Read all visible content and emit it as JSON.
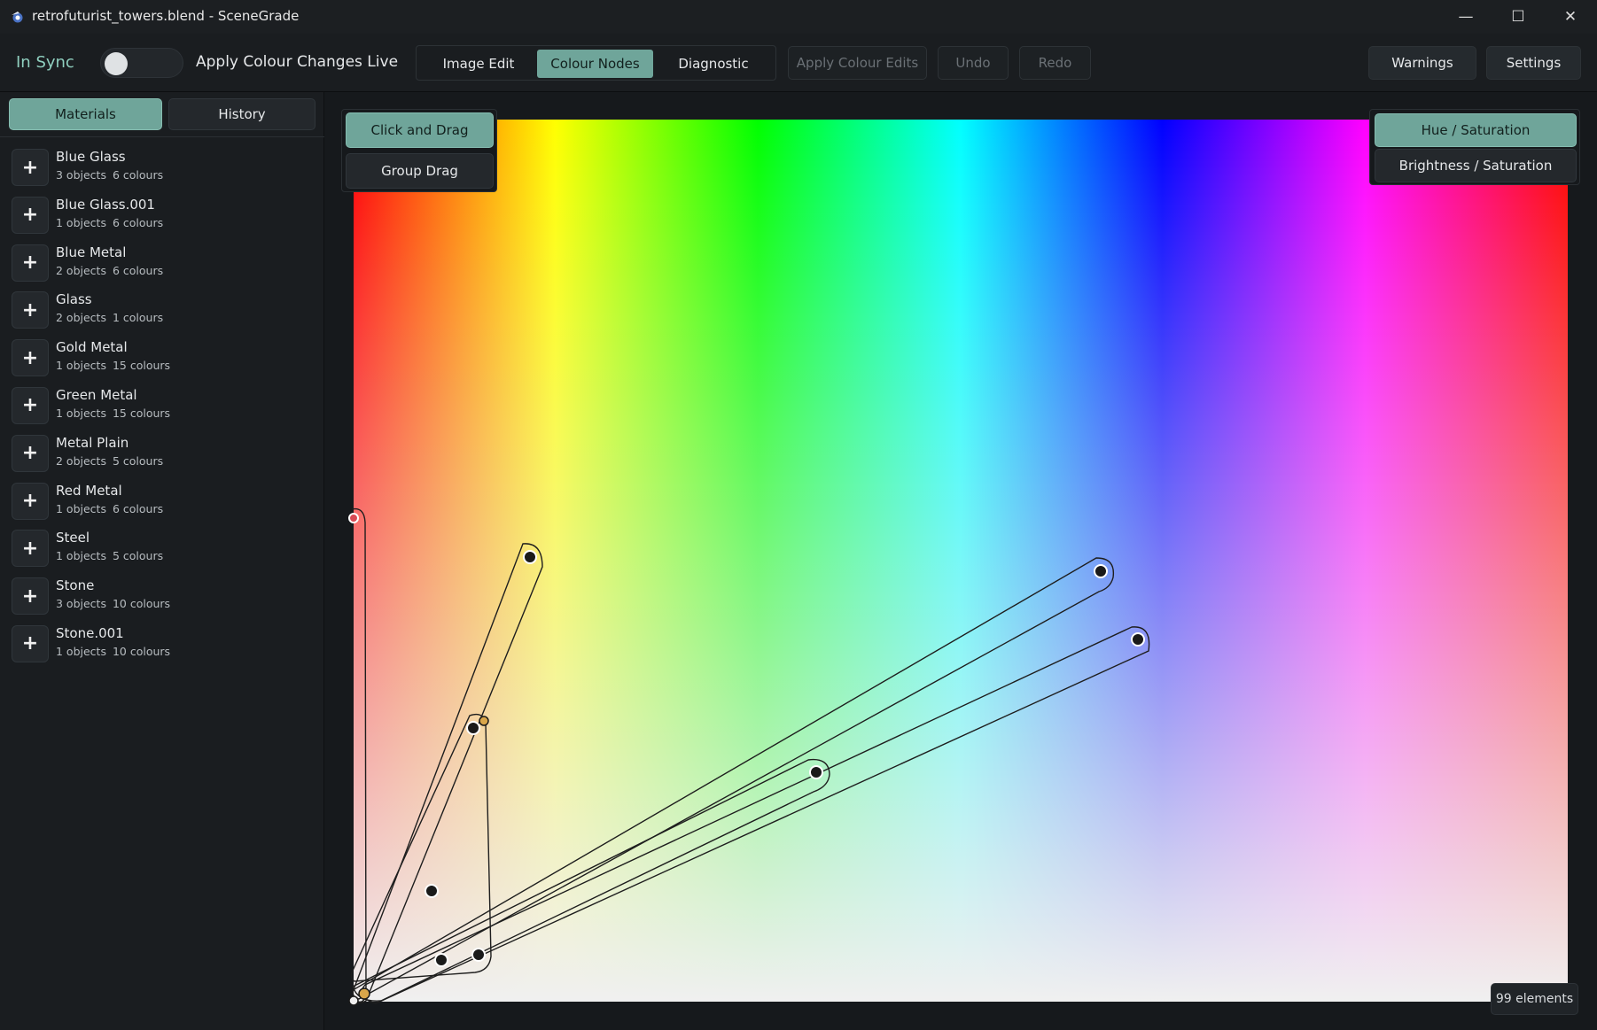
{
  "window": {
    "title": "retrofuturist_towers.blend - SceneGrade",
    "minimize_glyph": "—",
    "maximize_glyph": "☐",
    "close_glyph": "✕"
  },
  "toolbar": {
    "sync_status": "In Sync",
    "toggle_label": "Apply Colour Changes Live",
    "toggle_on": false,
    "tabs": [
      {
        "label": "Image Edit",
        "active": false
      },
      {
        "label": "Colour Nodes",
        "active": true
      },
      {
        "label": "Diagnostic",
        "active": false
      }
    ],
    "apply_label": "Apply Colour Edits",
    "undo_label": "Undo",
    "redo_label": "Redo",
    "warnings_label": "Warnings",
    "settings_label": "Settings"
  },
  "sidebar": {
    "tabs": [
      {
        "label": "Materials",
        "active": true
      },
      {
        "label": "History",
        "active": false
      }
    ],
    "add_glyph": "+",
    "materials": [
      {
        "name": "Blue Glass",
        "objects": "3 objects",
        "colours": "6 colours"
      },
      {
        "name": "Blue Glass.001",
        "objects": "1 objects",
        "colours": "6 colours"
      },
      {
        "name": "Blue Metal",
        "objects": "2 objects",
        "colours": "6 colours"
      },
      {
        "name": "Glass",
        "objects": "2 objects",
        "colours": "1 colours"
      },
      {
        "name": "Gold Metal",
        "objects": "1 objects",
        "colours": "15 colours"
      },
      {
        "name": "Green Metal",
        "objects": "1 objects",
        "colours": "15 colours"
      },
      {
        "name": "Metal Plain",
        "objects": "2 objects",
        "colours": "5 colours"
      },
      {
        "name": "Red Metal",
        "objects": "1 objects",
        "colours": "6 colours"
      },
      {
        "name": "Steel",
        "objects": "1 objects",
        "colours": "5 colours"
      },
      {
        "name": "Stone",
        "objects": "3 objects",
        "colours": "10 colours"
      },
      {
        "name": "Stone.001",
        "objects": "1 objects",
        "colours": "10 colours"
      }
    ]
  },
  "canvas": {
    "drag_modes": [
      {
        "label": "Click and Drag",
        "active": true
      },
      {
        "label": "Group Drag",
        "active": false
      }
    ],
    "view_modes": [
      {
        "label": "Hue / Saturation",
        "active": true
      },
      {
        "label": "Brightness / Saturation",
        "active": false
      }
    ],
    "element_count": "99 elements",
    "colors": {
      "accent": "#6fa59a",
      "node_fill": "#1a1a1a",
      "node_ring": "#ffffff",
      "selected_node": "#d9a64a"
    }
  }
}
